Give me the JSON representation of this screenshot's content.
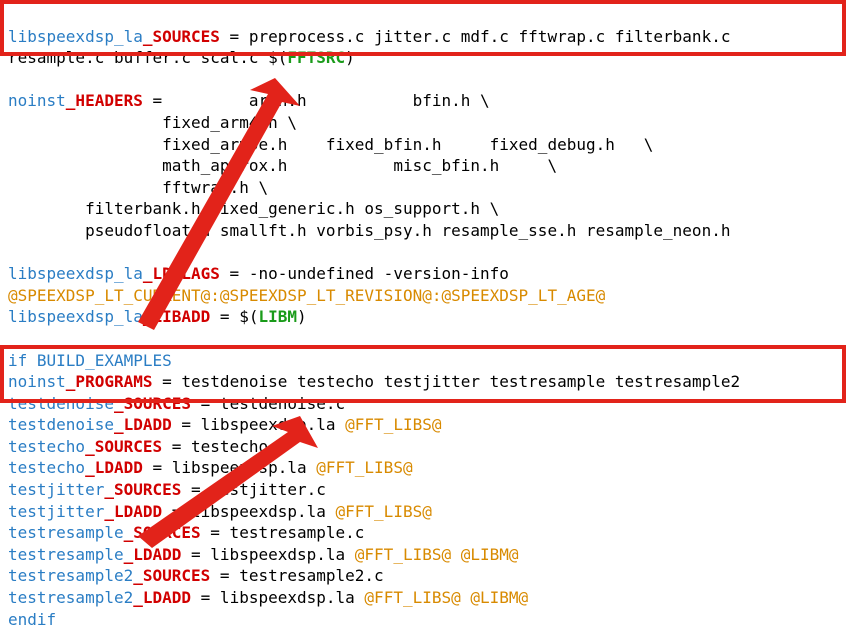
{
  "l1": {
    "a": "libspeexdsp_la",
    "b": "_SOURCES",
    "c": " = preprocess.c jitter.c mdf.c fftwrap.c filterbank.c "
  },
  "l2": {
    "a": "resample.c buffer.c scal.c $(",
    "b": "FFTSRC",
    "c": ")"
  },
  "l4": {
    "a": "noinst",
    "b": "_HEADERS",
    "c": " =         arch.h           bfin.h \\"
  },
  "l5": "                fixed_arm4.h \\",
  "l6": "                fixed_arm5e.h    fixed_bfin.h     fixed_debug.h   \\",
  "l7": "                math_approx.h           misc_bfin.h     \\",
  "l8": "                fftwrap.h \\",
  "l9": "        filterbank.h fixed_generic.h os_support.h \\",
  "l10": "        pseudofloat.h smallft.h vorbis_psy.h resample_sse.h resample_neon.h",
  "l12": {
    "a": "libspeexdsp_la",
    "b": "_LDFLAGS",
    "c": " = -no-undefined -version-info "
  },
  "l13": "@SPEEXDSP_LT_CURRENT@:@SPEEXDSP_LT_REVISION@:@SPEEXDSP_LT_AGE@",
  "l14": {
    "a": "libspeexdsp_la",
    "b": "_LIBADD",
    "c": " = $(",
    "d": "LIBM",
    "e": ")"
  },
  "l16": "if BUILD_EXAMPLES",
  "l17": {
    "a": "noinst",
    "b": "_PROGRAMS",
    "c": " = testdenoise testecho testjitter testresample testresample2"
  },
  "l18": {
    "a": "testdenoise",
    "b": "_SOURCES",
    "c": " = testdenoise.c"
  },
  "l19": {
    "a": "testdenoise",
    "b": "_LDADD",
    "c": " = libspeexdsp.la ",
    "d": "@FFT_LIBS@"
  },
  "l20": {
    "a": "testecho",
    "b": "_SOURCES",
    "c": " = testecho.c"
  },
  "l21": {
    "a": "testecho",
    "b": "_LDADD",
    "c": " = libspeexdsp.la ",
    "d": "@FFT_LIBS@"
  },
  "l22": {
    "a": "testjitter",
    "b": "_SOURCES",
    "c": " = testjitter.c"
  },
  "l23": {
    "a": "testjitter",
    "b": "_LDADD",
    "c": " = libspeexdsp.la ",
    "d": "@FFT_LIBS@"
  },
  "l24": {
    "a": "testresample",
    "b": "_SOURCES",
    "c": " = testresample.c"
  },
  "l25": {
    "a": "testresample",
    "b": "_LDADD",
    "c": " = libspeexdsp.la ",
    "d": "@FFT_LIBS@ @LIBM@"
  },
  "l26": {
    "a": "testresample2",
    "b": "_SOURCES",
    "c": " = testresample2.c"
  },
  "l27": {
    "a": "testresample2",
    "b": "_LDADD",
    "c": " = libspeexdsp.la ",
    "d": "@FFT_LIBS@ @LIBM@"
  },
  "l28": "endif",
  "blank": " "
}
